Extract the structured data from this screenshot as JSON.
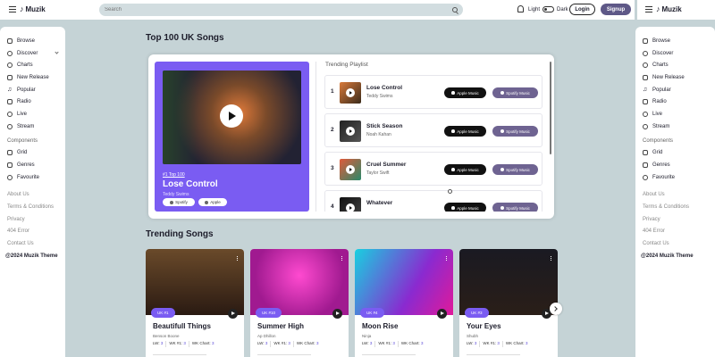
{
  "brand": "Muzik",
  "search": {
    "placeholder": "Search"
  },
  "theme": {
    "light": "Light",
    "dark": "Dark"
  },
  "auth": {
    "login": "Login",
    "signup": "Signup"
  },
  "sidebar": {
    "items": [
      {
        "label": "Browse"
      },
      {
        "label": "Discover"
      },
      {
        "label": "Charts"
      },
      {
        "label": "New Release"
      },
      {
        "label": "Popular"
      },
      {
        "label": "Radio"
      },
      {
        "label": "Live"
      },
      {
        "label": "Stream"
      }
    ],
    "components_heading": "Components",
    "components": [
      {
        "label": "Grid"
      },
      {
        "label": "Genres"
      },
      {
        "label": "Favourite"
      }
    ],
    "links": [
      {
        "label": "About Us"
      },
      {
        "label": "Terms & Conditions"
      },
      {
        "label": "Privacy"
      },
      {
        "label": "404 Error"
      },
      {
        "label": "Contact Us"
      }
    ],
    "copyright": "@2024 Muzik Theme"
  },
  "top_section": {
    "title": "Top 100 UK Songs"
  },
  "featured": {
    "tag": "#1 Top 100",
    "title": "Lose Control",
    "artist": "Teddy Swims",
    "spotify": "Spotify",
    "apple": "Apple"
  },
  "playlist": {
    "title": "Trending Playlist",
    "apple_label": "Apple Music",
    "spotify_label": "Spotify Music",
    "rows": [
      {
        "num": "1",
        "song": "Lose Control",
        "artist": "Teddy Swims"
      },
      {
        "num": "2",
        "song": "Stick Season",
        "artist": "Noah Kahan"
      },
      {
        "num": "3",
        "song": "Cruel Summer",
        "artist": "Taylor Swift"
      },
      {
        "num": "4",
        "song": "Whatever",
        "artist": ""
      }
    ]
  },
  "trending": {
    "title": "Trending Songs",
    "lw_label": "LW:",
    "wk1_label": "WK #1:",
    "chart_label": "WK Chart:",
    "cards": [
      {
        "badge": "UK #1",
        "title": "Beautifull Things",
        "artist": "Benson Boone",
        "lw": "3",
        "wk1": "3",
        "chart": "3"
      },
      {
        "badge": "UK #10",
        "title": "Summer High",
        "artist": "Ap Dhillon",
        "lw": "3",
        "wk1": "3",
        "chart": "3"
      },
      {
        "badge": "UK #4",
        "title": "Moon Rise",
        "artist": "Ninja",
        "lw": "3",
        "wk1": "3",
        "chart": "3"
      },
      {
        "badge": "UK #3",
        "title": "Your Eyes",
        "artist": "Shubh",
        "lw": "3",
        "wk1": "3",
        "chart": "3"
      }
    ]
  },
  "colors": {
    "accent": "#7a5cf2",
    "signup": "#5e5887",
    "spotify_btn": "#6e6391"
  }
}
